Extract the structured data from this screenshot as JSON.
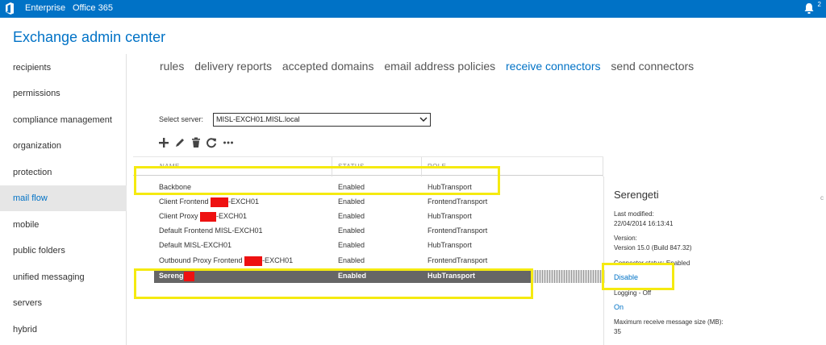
{
  "topbar": {
    "enterprise": "Enterprise",
    "office365": "Office 365",
    "notification_count": "2"
  },
  "app_title": "Exchange admin center",
  "sidebar": {
    "items": [
      {
        "label": "recipients"
      },
      {
        "label": "permissions"
      },
      {
        "label": "compliance management"
      },
      {
        "label": "organization"
      },
      {
        "label": "protection"
      },
      {
        "label": "mail flow",
        "active": true
      },
      {
        "label": "mobile"
      },
      {
        "label": "public folders"
      },
      {
        "label": "unified messaging"
      },
      {
        "label": "servers"
      },
      {
        "label": "hybrid"
      }
    ]
  },
  "tabs": [
    {
      "label": "rules"
    },
    {
      "label": "delivery reports"
    },
    {
      "label": "accepted domains"
    },
    {
      "label": "email address policies"
    },
    {
      "label": "receive connectors",
      "active": true
    },
    {
      "label": "send connectors"
    }
  ],
  "server": {
    "label": "Select server:",
    "value": "MISL-EXCH01.MISL.local"
  },
  "table": {
    "columns": [
      "NAME",
      "STATUS",
      "ROLE"
    ],
    "rows": [
      {
        "name_a": "Backbone",
        "name_b": "",
        "status": "Enabled",
        "role": "HubTransport"
      },
      {
        "name_a": "Client Frontend ",
        "name_b": "-EXCH01",
        "status": "Enabled",
        "role": "FrontendTransport"
      },
      {
        "name_a": "Client Proxy ",
        "name_b": "-EXCH01",
        "status": "Enabled",
        "role": "HubTransport"
      },
      {
        "name_a": "Default Frontend MISL-EXCH01",
        "name_b": "",
        "status": "Enabled",
        "role": "FrontendTransport"
      },
      {
        "name_a": "Default MISL-EXCH01",
        "name_b": "",
        "status": "Enabled",
        "role": "HubTransport"
      },
      {
        "name_a": "Outbound Proxy Frontend ",
        "name_b": "-EXCH01",
        "status": "Enabled",
        "role": "FrontendTransport"
      },
      {
        "name_a": "Sereng",
        "name_b": "",
        "status": "Enabled",
        "role": "HubTransport",
        "selected": true
      }
    ]
  },
  "details": {
    "title": "Serengeti",
    "last_modified_label": "Last modified:",
    "last_modified_value": "22/04/2014 16:13:41",
    "version_label": "Version:",
    "version_value": "Version 15.0 (Build 847.32)",
    "connector_status": "Connector status: Enabled",
    "disable_link": "Disable",
    "logging_label": "Logging - Off",
    "on_link": "On",
    "max_size_label": "Maximum receive message size (MB):",
    "max_size_value": "35"
  },
  "colors": {
    "brand": "#0072c6",
    "highlight": "#f5ea10",
    "redaction": "#ee1111",
    "selected_row": "#666666"
  }
}
